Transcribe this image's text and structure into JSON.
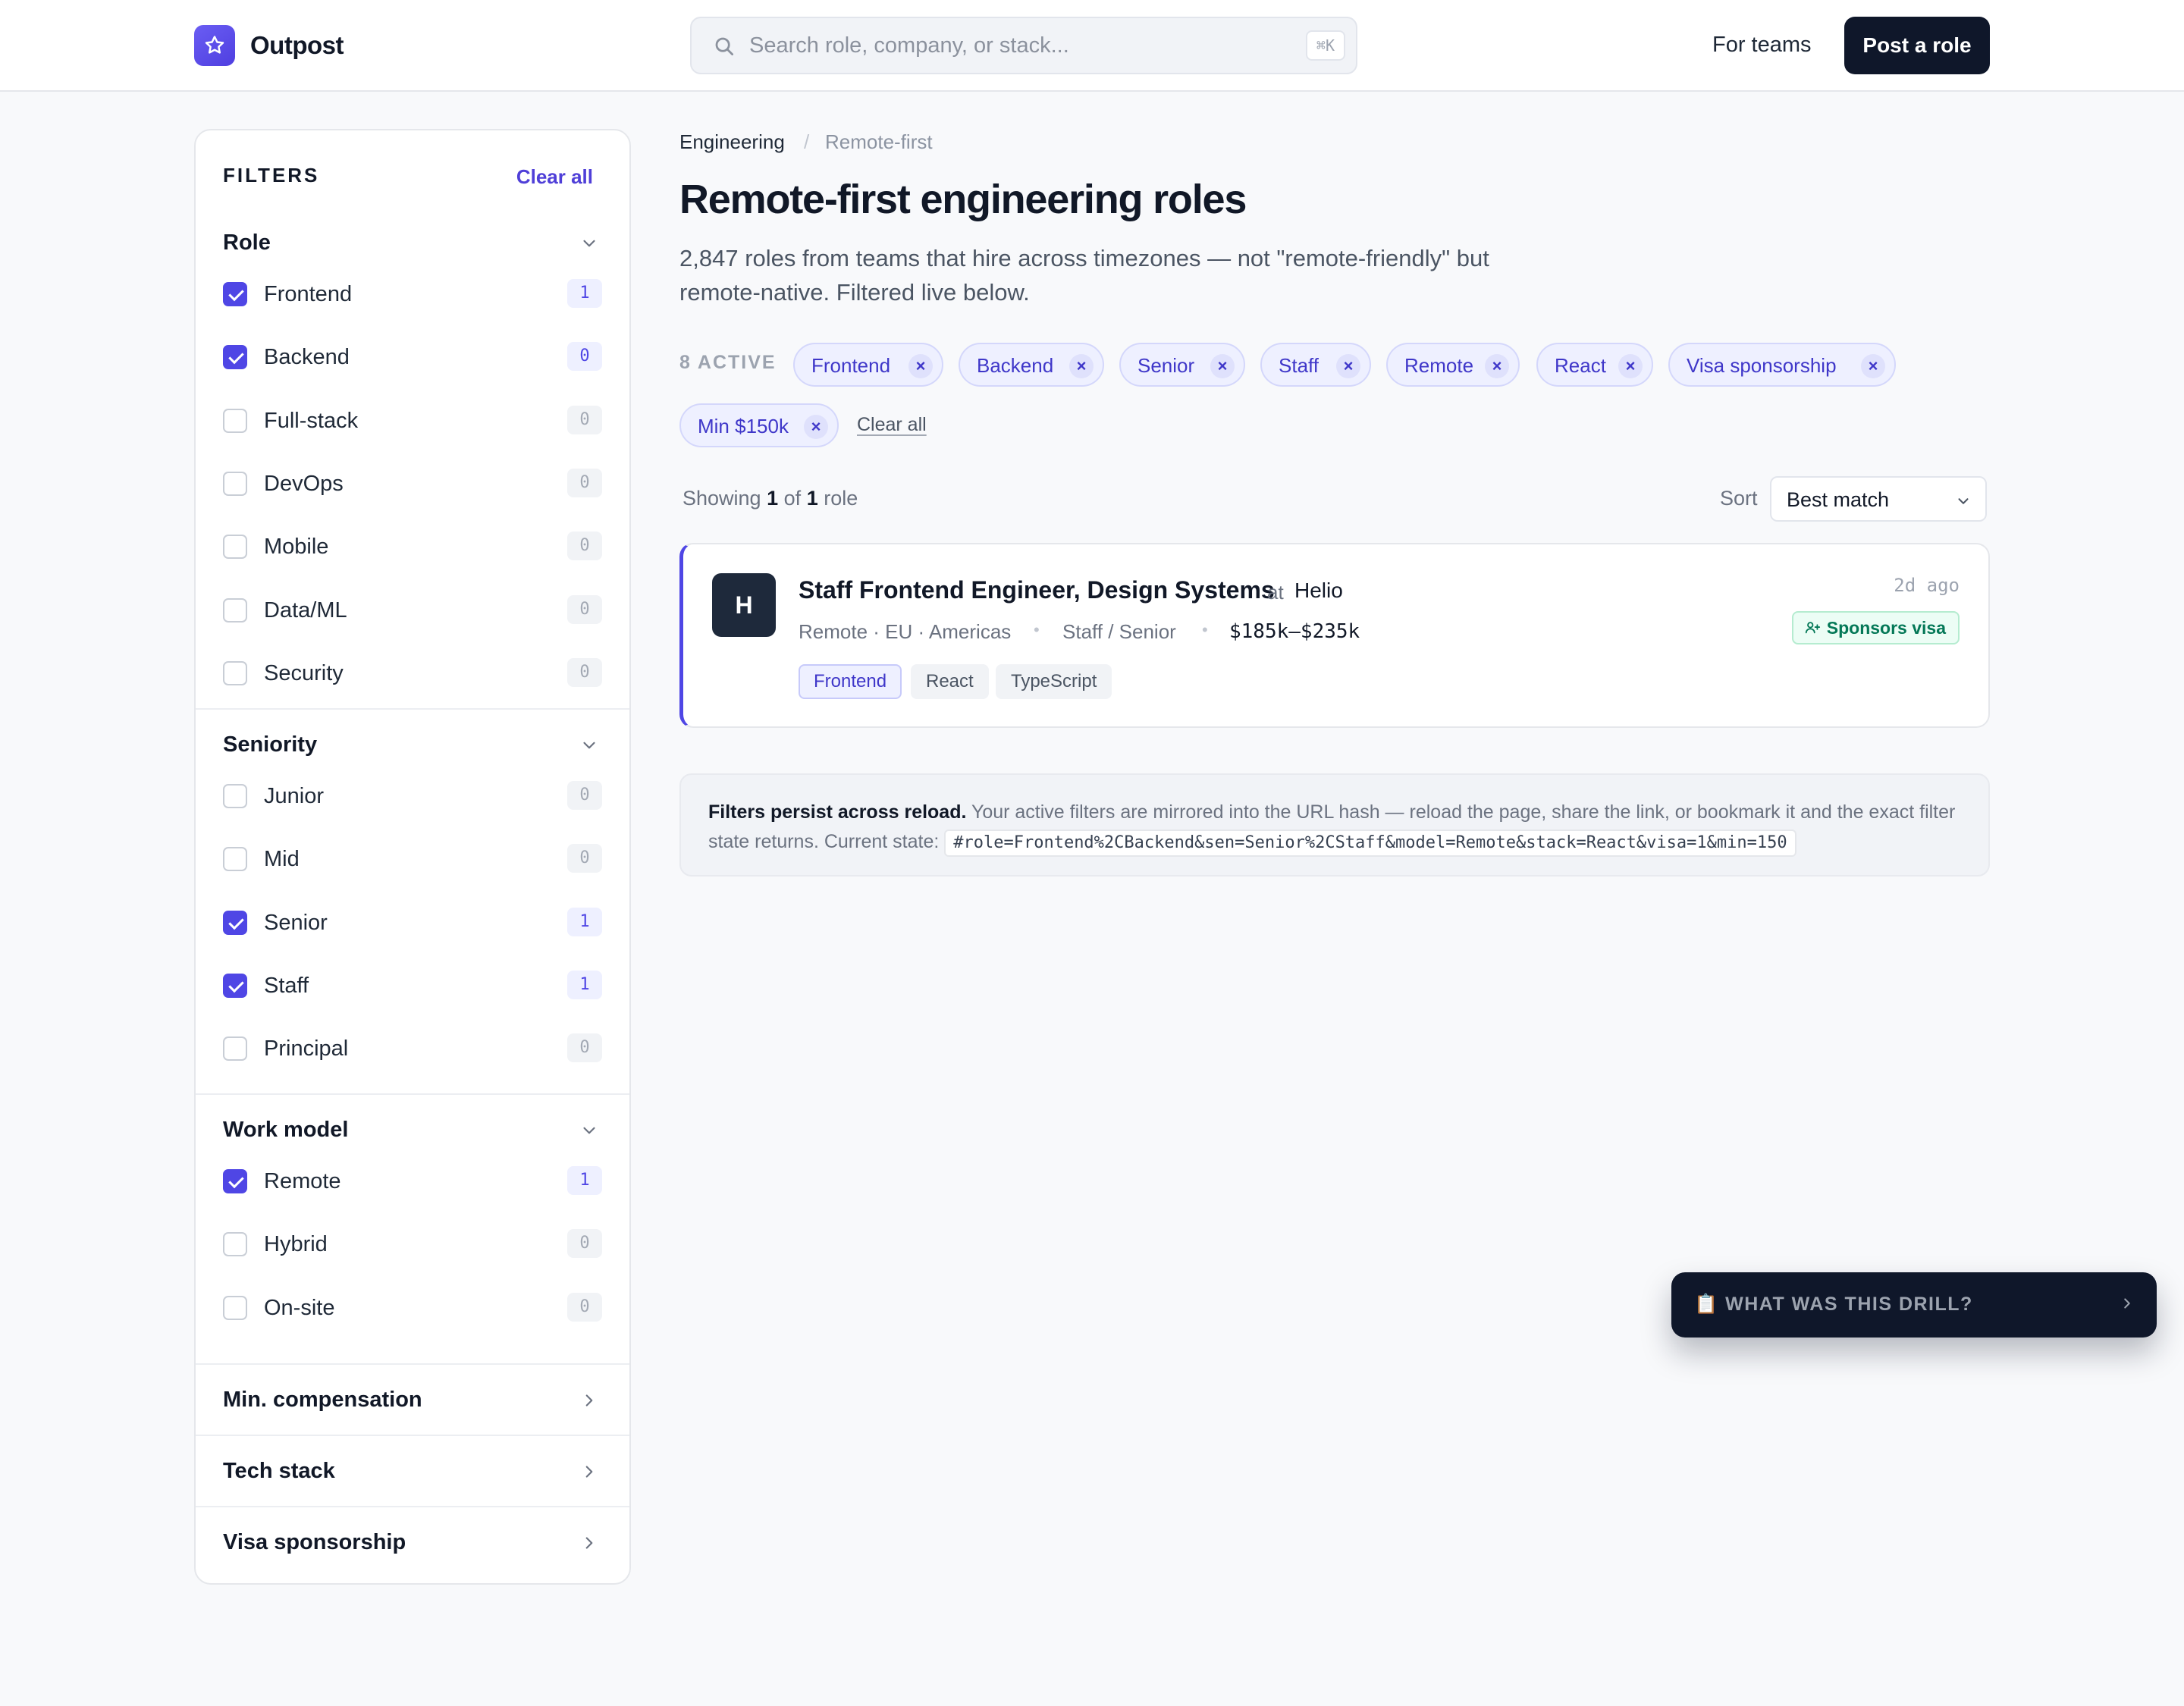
{
  "header": {
    "logo_text": "Outpost",
    "search_placeholder": "Search role, company, or stack...",
    "search_shortcut": "⌘K",
    "for_teams": "For teams",
    "post_role": "Post a role"
  },
  "sidebar": {
    "title": "FILTERS",
    "clear_all": "Clear all",
    "role": {
      "title": "Role",
      "options": [
        {
          "label": "Frontend",
          "checked": true,
          "count": "1"
        },
        {
          "label": "Backend",
          "checked": true,
          "count": "0"
        },
        {
          "label": "Full-stack",
          "checked": false,
          "count": "0"
        },
        {
          "label": "DevOps",
          "checked": false,
          "count": "0"
        },
        {
          "label": "Mobile",
          "checked": false,
          "count": "0"
        },
        {
          "label": "Data/ML",
          "checked": false,
          "count": "0"
        },
        {
          "label": "Security",
          "checked": false,
          "count": "0"
        }
      ]
    },
    "seniority": {
      "title": "Seniority",
      "options": [
        {
          "label": "Junior",
          "checked": false,
          "count": "0"
        },
        {
          "label": "Mid",
          "checked": false,
          "count": "0"
        },
        {
          "label": "Senior",
          "checked": true,
          "count": "1"
        },
        {
          "label": "Staff",
          "checked": true,
          "count": "1"
        },
        {
          "label": "Principal",
          "checked": false,
          "count": "0"
        }
      ]
    },
    "work_model": {
      "title": "Work model",
      "options": [
        {
          "label": "Remote",
          "checked": true,
          "count": "1"
        },
        {
          "label": "Hybrid",
          "checked": false,
          "count": "0"
        },
        {
          "label": "On-site",
          "checked": false,
          "count": "0"
        }
      ]
    },
    "collapsed_sections": [
      "Min. compensation",
      "Tech stack",
      "Visa sponsorship"
    ]
  },
  "main": {
    "breadcrumb": [
      "Engineering",
      "Remote-first"
    ],
    "title": "Remote-first engineering roles",
    "subtitle": "2,847 roles from teams that hire across timezones — not \"remote-friendly\" but remote-native. Filtered live below.",
    "active_label": "8 ACTIVE",
    "chips": [
      "Frontend",
      "Backend",
      "Senior",
      "Staff",
      "Remote",
      "React",
      "Visa sponsorship",
      "Min $150k"
    ],
    "chip_remove_glyph": "×",
    "clear_all": "Clear all",
    "showing": {
      "prefix": "Showing",
      "shown": "1",
      "of": "of",
      "total": "1",
      "suffix": "role"
    },
    "sort_label": "Sort",
    "sort_value": "Best match",
    "job": {
      "logo_letter": "H",
      "title": "Staff Frontend Engineer, Design Systems",
      "at": "at",
      "company": "Helio",
      "location": "Remote · EU · Americas",
      "level": "Staff / Senior",
      "salary": "$185k–$235k",
      "tags": [
        "Frontend",
        "React",
        "TypeScript"
      ],
      "posted": "2d ago",
      "visa_badge": "Sponsors visa"
    },
    "persist_note": {
      "bold": "Filters persist across reload.",
      "text": "Your active filters are mirrored into the URL hash — reload the page, share the link, or bookmark it and the exact filter state returns. Current state:",
      "state": "#role=Frontend%2CBackend&sen=Senior%2CStaff&model=Remote&stack=React&visa=1&min=150"
    }
  },
  "drill": {
    "emoji": "📋",
    "label": "WHAT WAS THIS DRILL?"
  },
  "colors": {
    "accent": "#4f46e5",
    "dark": "#0f172a",
    "success": "#047857"
  }
}
